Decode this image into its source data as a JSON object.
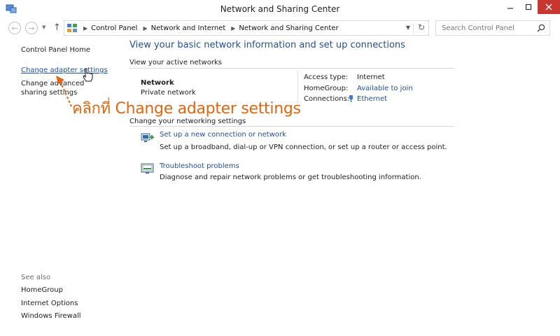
{
  "window": {
    "title": "Network and Sharing Center"
  },
  "navigation": {
    "breadcrumbs": [
      "Control Panel",
      "Network and Internet",
      "Network and Sharing Center"
    ],
    "search_placeholder": "Search Control Panel"
  },
  "sidebar": {
    "home": "Control Panel Home",
    "links": [
      "Change adapter settings",
      "Change advanced sharing settings"
    ],
    "see_also_heading": "See also",
    "see_also": [
      "HomeGroup",
      "Internet Options",
      "Windows Firewall"
    ]
  },
  "annotation": {
    "text": "คลิกที่ Change adapter settings",
    "color": "#e8640a"
  },
  "main": {
    "heading": "View your basic network information and set up connections",
    "active_networks_title": "View your active networks",
    "network": {
      "name": "Network",
      "type": "Private network",
      "access_type_label": "Access type:",
      "access_type_value": "Internet",
      "homegroup_label": "HomeGroup:",
      "homegroup_value": "Available to join",
      "connections_label": "Connections:",
      "connections_value": "Ethernet"
    },
    "change_settings_title": "Change your networking settings",
    "tasks": [
      {
        "icon": "new-connection-icon",
        "link": "Set up a new connection or network",
        "description": "Set up a broadband, dial-up or VPN connection, or set up a router or access point."
      },
      {
        "icon": "troubleshoot-icon",
        "link": "Troubleshoot problems",
        "description": "Diagnose and repair network problems or get troubleshooting information."
      }
    ]
  },
  "colors": {
    "link": "#1f4ea8",
    "close_button": "#c7372f"
  }
}
